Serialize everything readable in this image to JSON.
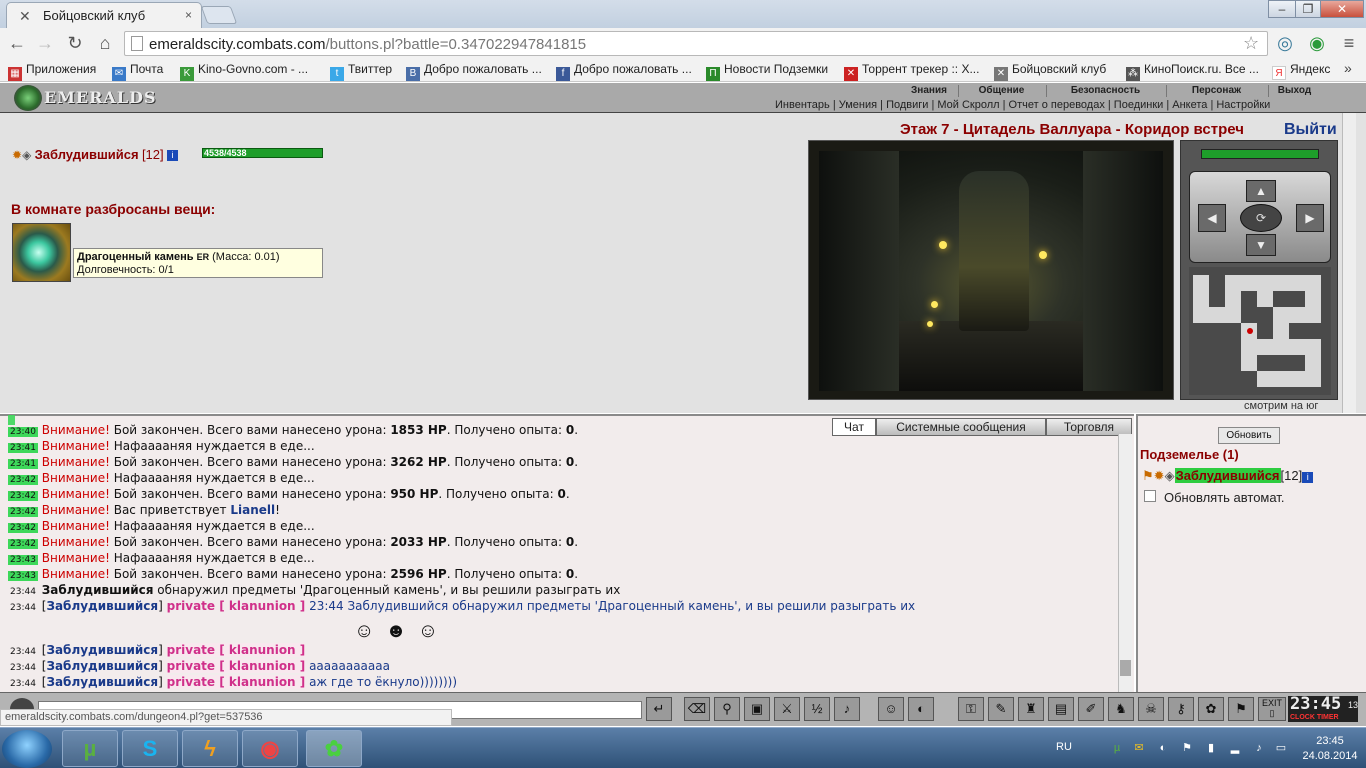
{
  "browser": {
    "tabs": [
      {
        "title": "Бойцовский клуб"
      }
    ],
    "url_host": "emeraldscity.combats.com",
    "url_path": "/buttons.pl?battle=0.347022947841815",
    "bookmarks": [
      {
        "label": "Приложения",
        "icon": "apps-grid-icon",
        "color": "#c33"
      },
      {
        "label": "Почта",
        "icon": "mail-icon",
        "color": "#3a7ac8"
      },
      {
        "label": "Kino-Govno.com - ...",
        "icon": "kg-icon",
        "color": "#3a9a3a"
      },
      {
        "label": "Твиттер",
        "icon": "twitter-icon",
        "color": "#3aa8e8"
      },
      {
        "label": "Добро пожаловать ...",
        "icon": "vk-icon",
        "color": "#4a6ea8"
      },
      {
        "label": "Добро пожаловать ...",
        "icon": "facebook-icon",
        "color": "#3b5998"
      },
      {
        "label": "Новости Подземки",
        "icon": "metro-icon",
        "color": "#2a8a2a"
      },
      {
        "label": "Торрент трекер :: Х...",
        "icon": "torrent-icon",
        "color": "#c22"
      },
      {
        "label": "Бойцовский клуб",
        "icon": "swords-icon",
        "color": "#777"
      },
      {
        "label": "КиноПоиск.ru. Все ...",
        "icon": "film-icon",
        "color": "#555"
      },
      {
        "label": "Яндекс",
        "icon": "yandex-icon",
        "color": "#e33"
      }
    ],
    "status_url": "emeraldscity.combats.com/dungeon4.pl?get=537536"
  },
  "game": {
    "logo_text": "EMERALDS",
    "top_menu": [
      "Знания",
      "Общение",
      "Безопасность",
      "Персонаж",
      "Выход"
    ],
    "sub_menu": "Инвентарь | Умения | Подвиги | Мой Скролл | Отчет о переводах | Поединки | Анкета | Настройки",
    "location": "Этаж 7 - Цитадель Валлуара - Коридор встреч",
    "exit_label": "Выйти",
    "player": {
      "name": "Заблудившийся",
      "level": "[12]",
      "info": "i",
      "hp": "4538/4538",
      "hp_fraction": 1.0
    },
    "items_heading": "В комнате разбросаны вещи:",
    "item": {
      "name": "Драгоценный камень",
      "tag": "ER",
      "mass": "(Масса: 0.01)",
      "durability": "Долговечность: 0/1"
    },
    "facing": "смотрим на юг"
  },
  "chat": {
    "tabs": [
      "Чат",
      "Системные сообщения",
      "Торговля"
    ],
    "lines": [
      {
        "time": "23:40",
        "warn": "Внимание!",
        "pre": " Бой закончен. Всего вами нанесено урона: ",
        "bold": "1853 HP",
        "post": ". Получено опыта: ",
        "bold2": "0",
        "end": "."
      },
      {
        "time": "23:41",
        "warn": "Внимание!",
        "pre": " Нафааааняя нуждается в еде...",
        "bold": "",
        "post": "",
        "bold2": "",
        "end": ""
      },
      {
        "time": "23:41",
        "warn": "Внимание!",
        "pre": " Бой закончен. Всего вами нанесено урона: ",
        "bold": "3262 HP",
        "post": ". Получено опыта: ",
        "bold2": "0",
        "end": "."
      },
      {
        "time": "23:42",
        "warn": "Внимание!",
        "pre": " Нафааааняя нуждается в еде...",
        "bold": "",
        "post": "",
        "bold2": "",
        "end": ""
      },
      {
        "time": "23:42",
        "warn": "Внимание!",
        "pre": " Бой закончен. Всего вами нанесено урона: ",
        "bold": "950 HP",
        "post": ". Получено опыта: ",
        "bold2": "0",
        "end": "."
      },
      {
        "time": "23:42",
        "warn": "Внимание!",
        "pre": " Вас приветствует ",
        "bold": "Lianell",
        "post": "!",
        "bold2": "",
        "end": ""
      },
      {
        "time": "23:42",
        "warn": "Внимание!",
        "pre": " Нафааааняя нуждается в еде...",
        "bold": "",
        "post": "",
        "bold2": "",
        "end": ""
      },
      {
        "time": "23:42",
        "warn": "Внимание!",
        "pre": " Бой закончен. Всего вами нанесено урона: ",
        "bold": "2033 HP",
        "post": ". Получено опыта: ",
        "bold2": "0",
        "end": "."
      },
      {
        "time": "23:43",
        "warn": "Внимание!",
        "pre": " Нафааааняя нуждается в еде...",
        "bold": "",
        "post": "",
        "bold2": "",
        "end": ""
      },
      {
        "time": "23:43",
        "warn": "Внимание!",
        "pre": " Бой закончен. Всего вами нанесено урона: ",
        "bold": "2596 HP",
        "post": ". Получено опыта: ",
        "bold2": "0",
        "end": "."
      }
    ],
    "sys_line": {
      "time": "23:44",
      "nick": "Заблудившийся",
      "text": " обнаружил предметы 'Драгоценный камень', и вы решили разыграть их"
    },
    "private_lines": [
      {
        "time": "23:44",
        "nick": "Заблудившийся",
        "priv": "private [ klanunion ]",
        "text": " 23:44 Заблудившийся обнаружил предметы 'Драгоценный камень', и вы решили разыграть их"
      },
      {
        "time": "23:44",
        "nick": "Заблудившийся",
        "priv": "private [ klanunion ]",
        "text": ""
      },
      {
        "time": "23:44",
        "nick": "Заблудившийся",
        "priv": "private [ klanunion ]",
        "text": " ааааааааааа"
      },
      {
        "time": "23:44",
        "nick": "Заблудившийся",
        "priv": "private [ klanunion ]",
        "text": " аж где то ёкнуло))))))))"
      }
    ]
  },
  "right_panel": {
    "refresh_label": "Обновить",
    "dungeon_title": "Подземелье (1)",
    "player_name": "Заблудившийся",
    "player_level": "[12]",
    "auto_label": "Обновлять автомат."
  },
  "clock": {
    "time": "23:45",
    "seconds": "13",
    "label": "CLOCK TIMER"
  },
  "taskbar": {
    "lang": "RU",
    "time": "23:45",
    "date": "24.08.2014"
  }
}
